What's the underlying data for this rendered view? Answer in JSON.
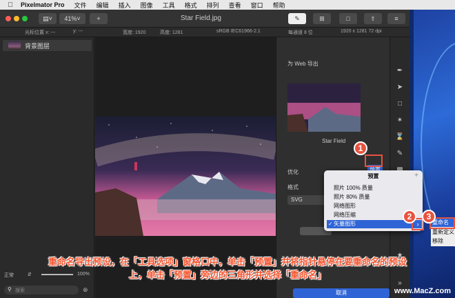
{
  "menubar": {
    "app": "Pixelmator Pro",
    "items": [
      "文件",
      "编辑",
      "插入",
      "图像",
      "工具",
      "格式",
      "排列",
      "查看",
      "窗口",
      "帮助"
    ]
  },
  "toolbar": {
    "zoom": "41%",
    "title": "Star Field.jpg"
  },
  "info": {
    "cursor": "光标位置 x: ---",
    "y": "y: ---",
    "width": "宽度: 1920",
    "height": "高度: 1281",
    "colorspace": "sRGB IEC61966-2.1",
    "depth": "每通道 8 位",
    "dims": "1920 x 1281 72 dpi"
  },
  "layers": {
    "item": "背景图层",
    "blend": "正常",
    "opacity": "100%",
    "search_placeholder": "搜索"
  },
  "export": {
    "header": "为 Web 导出",
    "preview_name": "Star Field",
    "preset_button": "预置",
    "optimize": "优化",
    "format_label": "格式",
    "format_value": "SVG"
  },
  "popup": {
    "title": "预置",
    "items": [
      "照片 100% 质量",
      "照片 80% 质量",
      "网络图形",
      "网络压缩",
      "矢量图形"
    ],
    "checked_index": 4
  },
  "submenu": {
    "items": [
      "重命名",
      "重新定义",
      "移除"
    ]
  },
  "steps": [
    "1",
    "2",
    "3"
  ],
  "caption": {
    "line1": "重命名导出预设，在「工具选项」窗格口中，单击「预置」并将指针悬停在要重命名的预设",
    "line2": "上，单击「预置」旁边的三角形并选择「重命名」"
  },
  "bottom_button": "取消",
  "watermark": "www.MacZ.com",
  "colors": {
    "accent": "#2f64d6",
    "highlight": "#e8533f"
  }
}
